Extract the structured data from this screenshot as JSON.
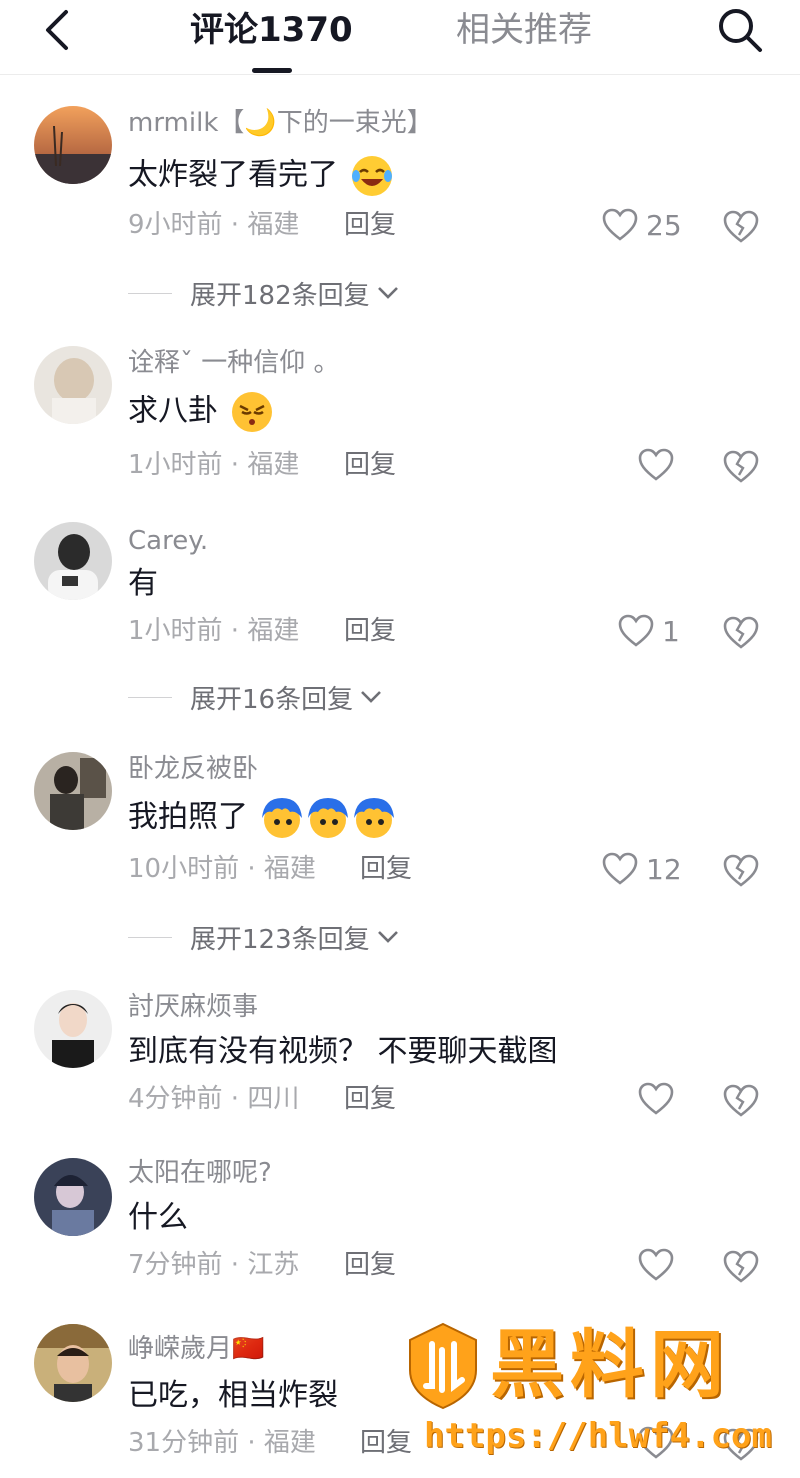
{
  "header": {
    "tab_comments": "评论1370",
    "tab_recommend": "相关推荐"
  },
  "comments": [
    {
      "username": "mrmilk【🌙下的一束光】",
      "text": "太炸裂了看完了",
      "emoji": "laughing-crying",
      "time": "9小时前",
      "location": "福建",
      "reply": "回复",
      "likes": "25",
      "expand": "展开182条回复"
    },
    {
      "username": "诠释ˇ 一种信仰 。",
      "text": "求八卦",
      "emoji": "curious-face",
      "time": "1小时前",
      "location": "福建",
      "reply": "回复",
      "likes": "",
      "expand": ""
    },
    {
      "username": "Carey.",
      "text": "有",
      "emoji": "",
      "time": "1小时前",
      "location": "福建",
      "reply": "回复",
      "likes": "1",
      "expand": "展开16条回复"
    },
    {
      "username": "卧龙反被卧",
      "text": "我拍照了",
      "emoji": "blue-hair-face x3",
      "time": "10小时前",
      "location": "福建",
      "reply": "回复",
      "likes": "12",
      "expand": "展开123条回复"
    },
    {
      "username": "討厌麻烦事",
      "text": "到底有没有视频？ 不要聊天截图",
      "emoji": "",
      "time": "4分钟前",
      "location": "四川",
      "reply": "回复",
      "likes": "",
      "expand": ""
    },
    {
      "username": "太阳在哪呢?",
      "text": "什么",
      "emoji": "",
      "time": "7分钟前",
      "location": "江苏",
      "reply": "回复",
      "likes": "",
      "expand": ""
    },
    {
      "username": "峥嵘歲月🇨🇳",
      "text": "已吃，相当炸裂",
      "emoji": "",
      "time": "31分钟前",
      "location": "福建",
      "reply": "回复",
      "likes": "",
      "expand": ""
    }
  ],
  "watermark": {
    "title": "黑料网",
    "url": "https://hlwf4.com"
  },
  "colors": {
    "accent_watermark": "#ffa21a",
    "text_primary": "#161823",
    "text_secondary": "#8a8b91"
  }
}
